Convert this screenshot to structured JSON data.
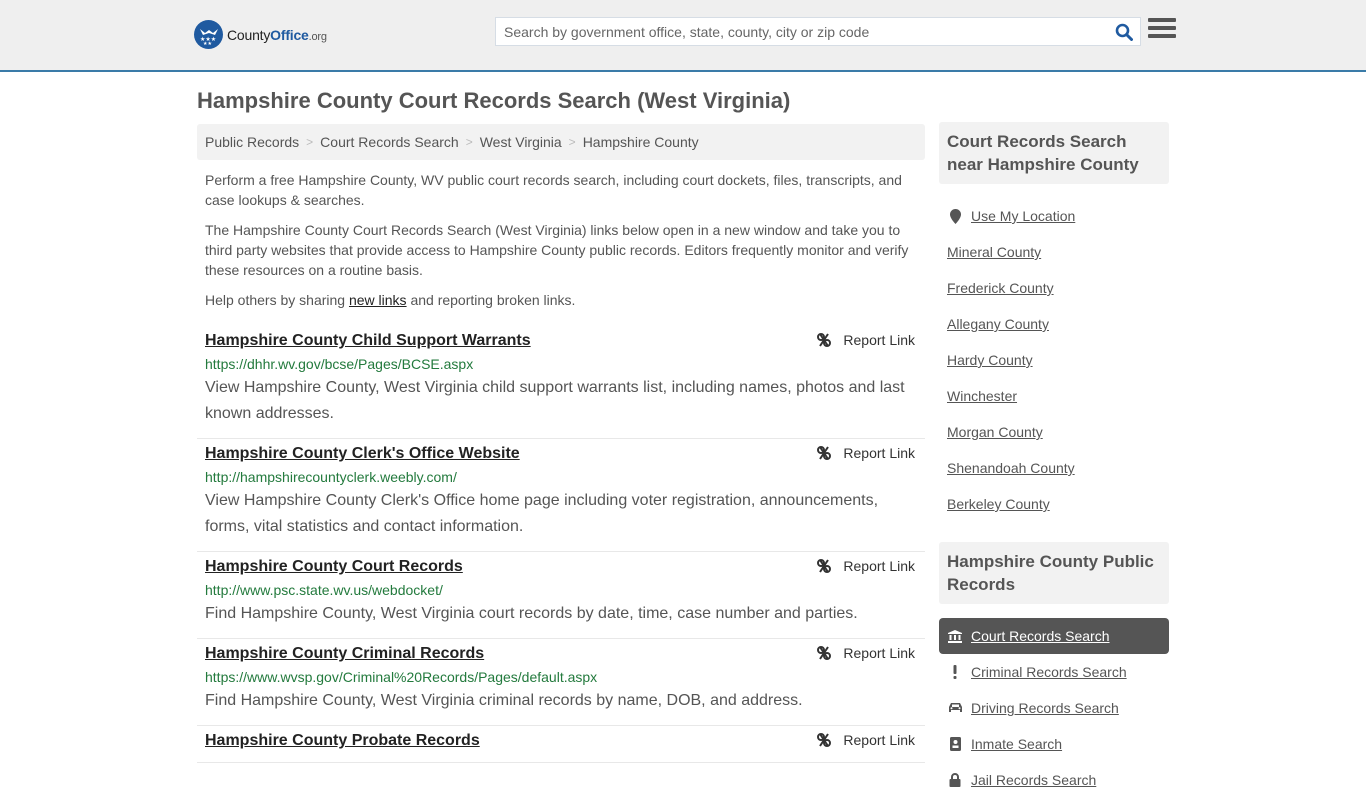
{
  "header": {
    "logo": {
      "county": "County",
      "office": "Office",
      "org": ".org"
    },
    "search": {
      "placeholder": "Search by government office, state, county, city or zip code",
      "value": ""
    },
    "icons": {
      "search": "search-icon",
      "menu": "hamburger-menu-icon"
    }
  },
  "page": {
    "title": "Hampshire County Court Records Search (West Virginia)"
  },
  "breadcrumb": [
    {
      "label": "Public Records"
    },
    {
      "label": "Court Records Search"
    },
    {
      "label": "West Virginia"
    },
    {
      "label": "Hampshire County"
    }
  ],
  "intro": {
    "p1": "Perform a free Hampshire County, WV public court records search, including court dockets, files, transcripts, and case lookups & searches.",
    "p2": "The Hampshire County Court Records Search (West Virginia) links below open in a new window and take you to third party websites that provide access to Hampshire County public records. Editors frequently monitor and verify these resources on a routine basis.",
    "p3_before": "Help others by sharing ",
    "p3_link": "new links",
    "p3_after": " and reporting broken links."
  },
  "results": [
    {
      "title": "Hampshire County Child Support Warrants",
      "url": "https://dhhr.wv.gov/bcse/Pages/BCSE.aspx",
      "description": "View Hampshire County, West Virginia child support warrants list, including names, photos and last known addresses.",
      "report_label": "Report Link"
    },
    {
      "title": "Hampshire County Clerk's Office Website",
      "url": "http://hampshirecountyclerk.weebly.com/",
      "description": "View Hampshire County Clerk's Office home page including voter registration, announcements, forms, vital statistics and contact information.",
      "report_label": "Report Link"
    },
    {
      "title": "Hampshire County Court Records",
      "url": "http://www.psc.state.wv.us/webdocket/",
      "description": "Find Hampshire County, West Virginia court records by date, time, case number and parties.",
      "report_label": "Report Link"
    },
    {
      "title": "Hampshire County Criminal Records",
      "url": "https://www.wvsp.gov/Criminal%20Records/Pages/default.aspx",
      "description": "Find Hampshire County, West Virginia criminal records by name, DOB, and address.",
      "report_label": "Report Link"
    },
    {
      "title": "Hampshire County Probate Records",
      "url": "",
      "description": "",
      "report_label": "Report Link"
    }
  ],
  "sidebar": {
    "nearby_heading": "Court Records Search near Hampshire County",
    "use_location": "Use My Location",
    "nearby": [
      {
        "label": "Mineral County"
      },
      {
        "label": "Frederick County"
      },
      {
        "label": "Allegany County"
      },
      {
        "label": "Hardy County"
      },
      {
        "label": "Winchester"
      },
      {
        "label": "Morgan County"
      },
      {
        "label": "Shenandoah County"
      },
      {
        "label": "Berkeley County"
      }
    ],
    "public_heading": "Hampshire County Public Records",
    "public_links": [
      {
        "label": "Court Records Search",
        "icon": "courthouse-icon",
        "active": true
      },
      {
        "label": "Criminal Records Search",
        "icon": "exclamation-icon",
        "active": false
      },
      {
        "label": "Driving Records Search",
        "icon": "car-icon",
        "active": false
      },
      {
        "label": "Inmate Search",
        "icon": "id-badge-icon",
        "active": false
      },
      {
        "label": "Jail Records Search",
        "icon": "lock-icon",
        "active": false
      }
    ]
  }
}
